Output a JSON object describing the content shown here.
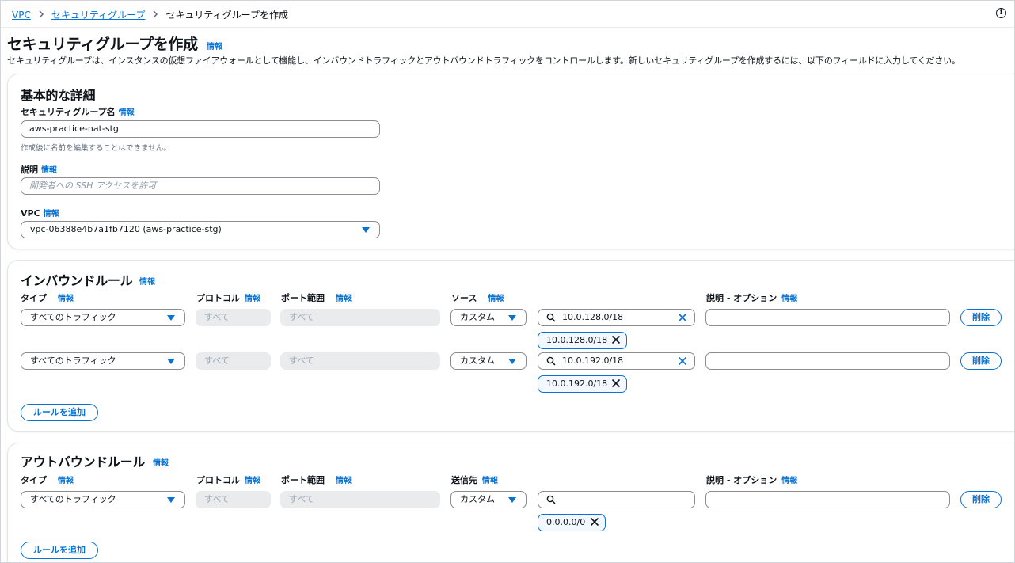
{
  "breadcrumb": {
    "items": [
      "VPC",
      "セキュリティグループ"
    ],
    "current": "セキュリティグループを作成"
  },
  "header": {
    "title": "セキュリティグループを作成",
    "info": "情報",
    "description": "セキュリティグループは、インスタンスの仮想ファイアウォールとして機能し、インバウンドトラフィックとアウトバウンドトラフィックをコントロールします。新しいセキュリティグループを作成するには、以下のフィールドに入力してください。"
  },
  "info_label": "情報",
  "basic": {
    "title": "基本的な詳細",
    "name_label": "セキュリティグループ名",
    "name_value": "aws-practice-nat-stg",
    "name_hint": "作成後に名前を編集することはできません。",
    "desc_label": "説明",
    "desc_placeholder": "開発者への SSH アクセスを許可",
    "vpc_label": "VPC",
    "vpc_value": "vpc-06388e4b7a1fb7120 (aws-practice-stg)"
  },
  "columns": {
    "type": "タイプ",
    "protocol": "プロトコル",
    "port": "ポート範囲",
    "source": "ソース",
    "destination": "送信先",
    "description": "説明 - オプション"
  },
  "inbound": {
    "title": "インバウンドルール",
    "rules": [
      {
        "type": "すべてのトラフィック",
        "protocol": "すべて",
        "port": "すべて",
        "source": "カスタム",
        "search": "10.0.128.0/18",
        "token": "10.0.128.0/18",
        "delete": "削除"
      },
      {
        "type": "すべてのトラフィック",
        "protocol": "すべて",
        "port": "すべて",
        "source": "カスタム",
        "search": "10.0.192.0/18",
        "token": "10.0.192.0/18",
        "delete": "削除"
      }
    ],
    "add_label": "ルールを追加"
  },
  "outbound": {
    "title": "アウトバウンドルール",
    "rules": [
      {
        "type": "すべてのトラフィック",
        "protocol": "すべて",
        "port": "すべて",
        "destination": "カスタム",
        "search": "",
        "token": "0.0.0.0/0",
        "delete": "削除"
      }
    ],
    "add_label": "ルールを追加"
  },
  "colors": {
    "accent": "#0972d3",
    "text": "#0f141a",
    "muted": "#5f6b7a"
  }
}
